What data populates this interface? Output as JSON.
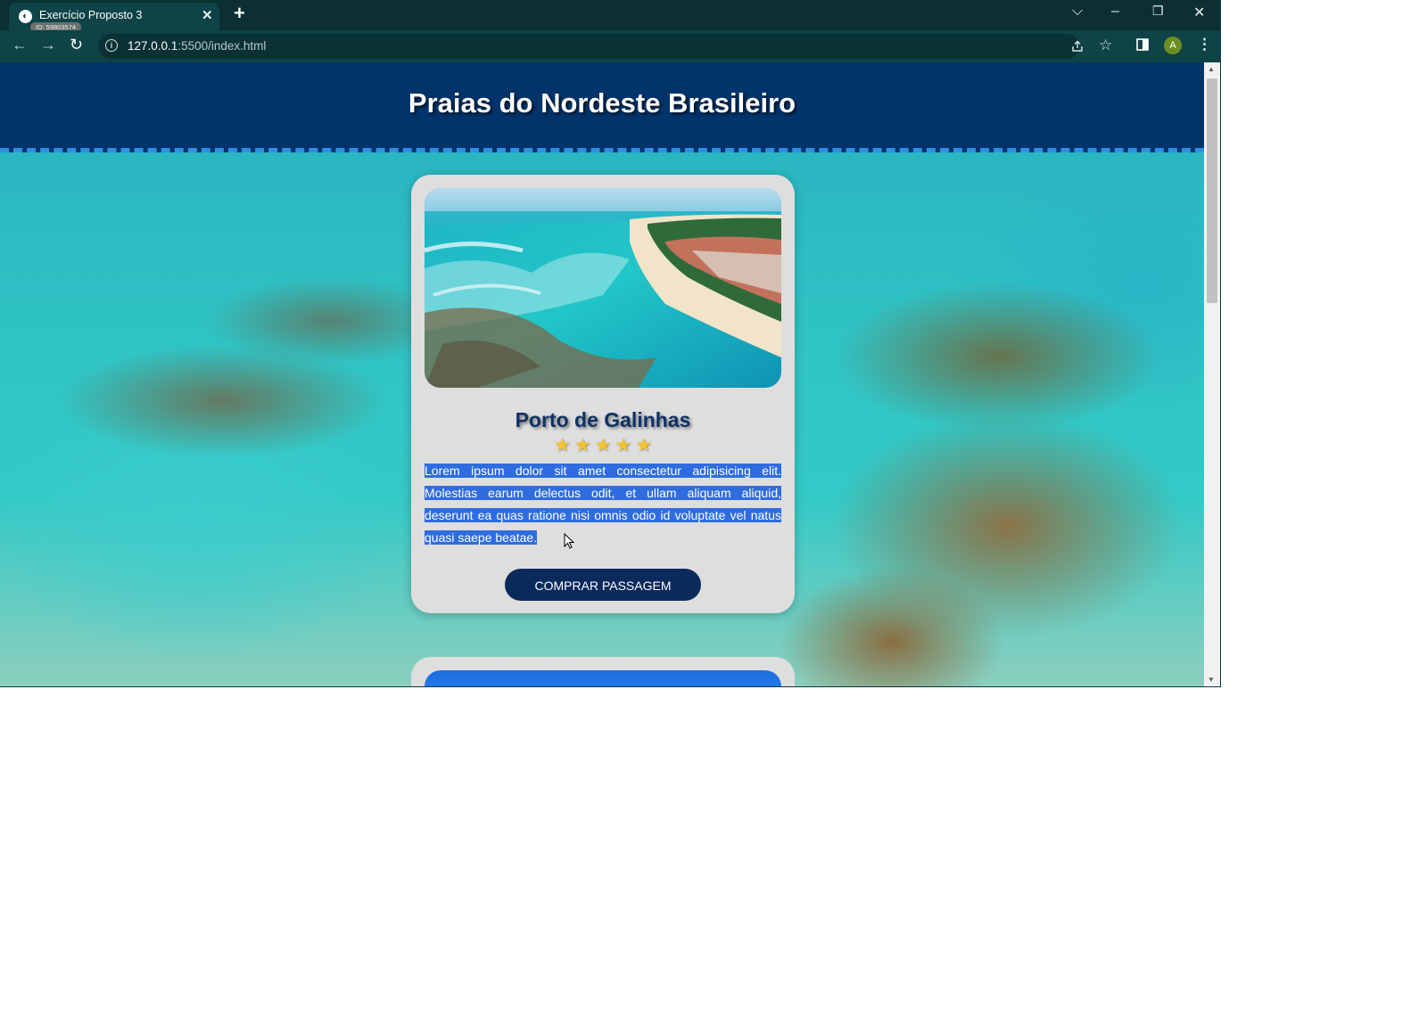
{
  "browser": {
    "tab": {
      "title": "Exercício Proposto 3",
      "id_badge": "ID: 59803574",
      "close": "✕"
    },
    "new_tab": "+",
    "window_controls": {
      "list": "⌵",
      "minimize": "–",
      "restore": "❐",
      "close": "✕"
    },
    "nav": {
      "back": "←",
      "forward": "→",
      "reload": "↻"
    },
    "url": {
      "host": "127.0.0.1",
      "path": ":5500/index.html"
    },
    "profile_initial": "A",
    "icons": [
      "info-icon",
      "share-icon",
      "star-icon",
      "sidebar-icon",
      "menu-icon"
    ]
  },
  "page": {
    "title": "Praias do Nordeste Brasileiro",
    "card": {
      "title": "Porto de Galinhas",
      "rating": 5,
      "stars": [
        "★",
        "★",
        "★",
        "★",
        "★"
      ],
      "text": "Lorem ipsum dolor sit amet consectetur adipisicing elit. Molestias earum delectus odit, et ullam aliquam aliquid, deserunt ea quas ratione nisi omnis odio id voluptate vel natus quasi saepe beatae.",
      "button": "COMPRAR PASSAGEM"
    }
  },
  "colors": {
    "header_bg": "#01346b",
    "header_border": "#2f8fe6",
    "card_bg": "#dedede",
    "title_color": "#0f3166",
    "button_bg": "#0b2a5c",
    "selection": "#2f6ce0",
    "star": "#f4c430"
  }
}
